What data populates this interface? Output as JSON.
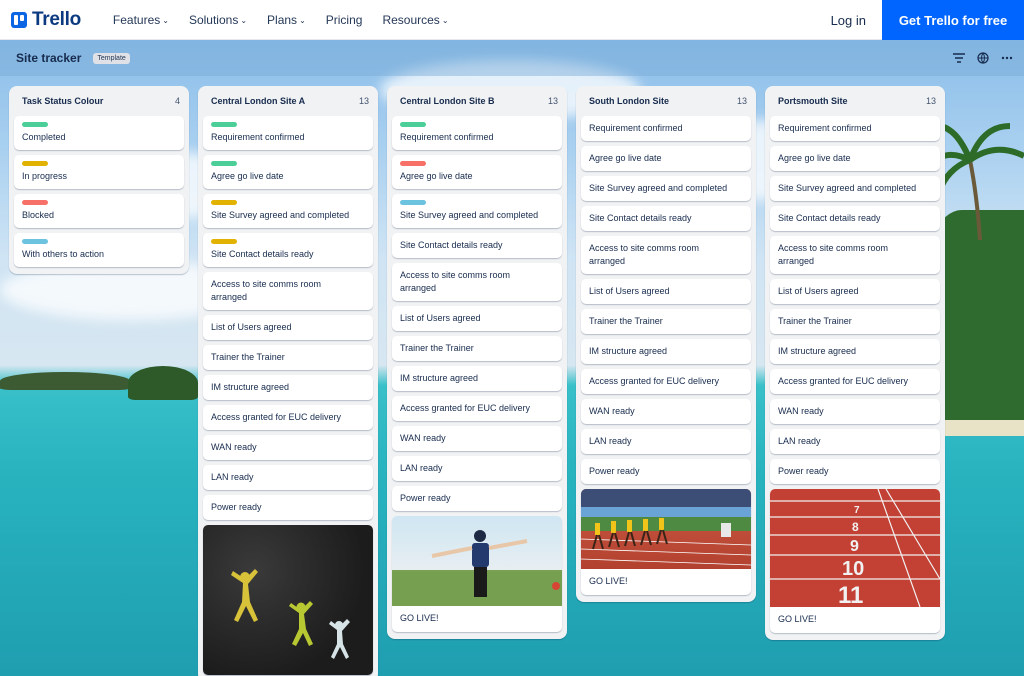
{
  "nav": {
    "logo": "Trello",
    "links": [
      {
        "label": "Features",
        "chevron": true
      },
      {
        "label": "Solutions",
        "chevron": true
      },
      {
        "label": "Plans",
        "chevron": true
      },
      {
        "label": "Pricing",
        "chevron": false
      },
      {
        "label": "Resources",
        "chevron": true
      }
    ],
    "login": "Log in",
    "cta": "Get Trello for free",
    "accent": "#0065ff"
  },
  "board": {
    "title": "Site tracker",
    "tag": "Template",
    "icons": [
      "filter-icon",
      "globe-icon",
      "more-icon"
    ]
  },
  "label_colors": {
    "green": "#4bce97",
    "yellow": "#e2b203",
    "red": "#f87168",
    "blue": "#6cc3e0"
  },
  "lists": [
    {
      "title": "Task Status Colour",
      "count": "4",
      "cards": [
        {
          "text": "Completed",
          "label": "green"
        },
        {
          "text": "In progress",
          "label": "yellow"
        },
        {
          "text": "Blocked",
          "label": "red"
        },
        {
          "text": "With others to action",
          "label": "blue"
        }
      ]
    },
    {
      "title": "Central London Site A",
      "count": "13",
      "cards": [
        {
          "text": "Requirement confirmed",
          "label": "green"
        },
        {
          "text": "Agree go live date",
          "label": "green"
        },
        {
          "text": "Site Survey agreed and completed",
          "label": "yellow"
        },
        {
          "text": "Site Contact details ready",
          "label": "yellow"
        },
        {
          "text": "Access to site comms room arranged"
        },
        {
          "text": "List of Users agreed"
        },
        {
          "text": "Trainer the Trainer"
        },
        {
          "text": "IM structure agreed"
        },
        {
          "text": "Access granted for EUC delivery"
        },
        {
          "text": "WAN ready"
        },
        {
          "text": "LAN ready"
        },
        {
          "text": "Power ready"
        },
        {
          "image": "chalk-figures"
        }
      ]
    },
    {
      "title": "Central London Site B",
      "count": "13",
      "cards": [
        {
          "text": "Requirement confirmed",
          "label": "green"
        },
        {
          "text": "Agree go live date",
          "label": "red"
        },
        {
          "text": "Site Survey agreed and completed",
          "label": "blue"
        },
        {
          "text": "Site Contact details ready"
        },
        {
          "text": "Access to site comms room arranged"
        },
        {
          "text": "List of Users agreed"
        },
        {
          "text": "Trainer the Trainer"
        },
        {
          "text": "IM structure agreed"
        },
        {
          "text": "Access granted for EUC delivery"
        },
        {
          "text": "WAN ready"
        },
        {
          "text": "LAN ready"
        },
        {
          "text": "Power ready"
        },
        {
          "text": "GO LIVE!",
          "image": "cyclist"
        }
      ]
    },
    {
      "title": "South London Site",
      "count": "13",
      "cards": [
        {
          "text": "Requirement confirmed"
        },
        {
          "text": "Agree go live date"
        },
        {
          "text": "Site Survey agreed and completed"
        },
        {
          "text": "Site Contact details ready"
        },
        {
          "text": "Access to site comms room arranged"
        },
        {
          "text": "List of Users agreed"
        },
        {
          "text": "Trainer the Trainer"
        },
        {
          "text": "IM structure agreed"
        },
        {
          "text": "Access granted for EUC delivery"
        },
        {
          "text": "WAN ready"
        },
        {
          "text": "LAN ready"
        },
        {
          "text": "Power ready"
        },
        {
          "text": "GO LIVE!",
          "image": "sprinters"
        }
      ]
    },
    {
      "title": "Portsmouth Site",
      "count": "13",
      "cards": [
        {
          "text": "Requirement confirmed"
        },
        {
          "text": "Agree go live date"
        },
        {
          "text": "Site Survey agreed and completed"
        },
        {
          "text": "Site Contact details ready"
        },
        {
          "text": "Access to site comms room arranged"
        },
        {
          "text": "List of Users agreed"
        },
        {
          "text": "Trainer the Trainer"
        },
        {
          "text": "IM structure agreed"
        },
        {
          "text": "Access granted for EUC delivery"
        },
        {
          "text": "WAN ready"
        },
        {
          "text": "LAN ready"
        },
        {
          "text": "Power ready"
        },
        {
          "text": "GO LIVE!",
          "image": "track-lanes"
        }
      ]
    }
  ]
}
